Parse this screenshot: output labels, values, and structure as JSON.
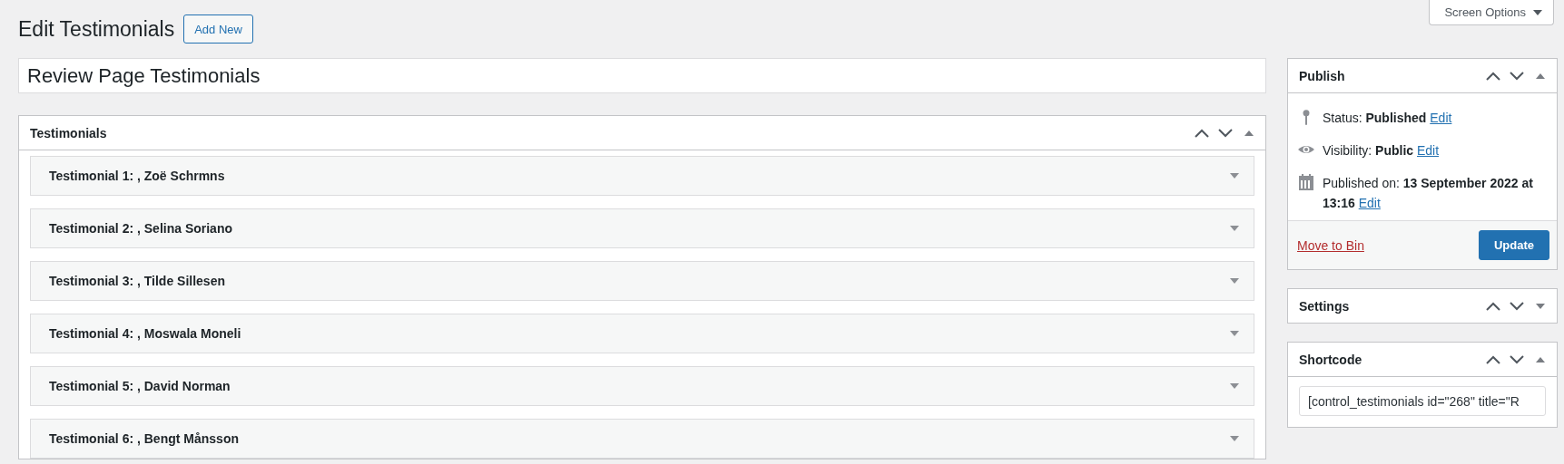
{
  "screen_options": {
    "label": "Screen Options",
    "expanded": false
  },
  "heading": {
    "title": "Edit Testimonials",
    "add_new": "Add New"
  },
  "title_field": {
    "value": "Review Page Testimonials"
  },
  "testimonials_panel": {
    "title": "Testimonials",
    "expanded": true,
    "items": [
      {
        "label": "Testimonial 1: , Zoë Schrmns",
        "expanded": false
      },
      {
        "label": "Testimonial 2: , Selina Soriano",
        "expanded": false
      },
      {
        "label": "Testimonial 3: , Tilde Sillesen",
        "expanded": false
      },
      {
        "label": "Testimonial 4: , Moswala Moneli",
        "expanded": false
      },
      {
        "label": "Testimonial 5: , David Norman",
        "expanded": false
      },
      {
        "label": "Testimonial 6: , Bengt Månsson",
        "expanded": false
      }
    ]
  },
  "publish": {
    "title": "Publish",
    "expanded": true,
    "rows": [
      {
        "kind": "pin",
        "text": "Status: **Published**",
        "link": "Edit"
      },
      {
        "kind": "eye",
        "text": "Visibility: **Public**",
        "link": "Edit"
      },
      {
        "kind": "calendar",
        "text": "Published on: **13 September 2022 at 13:16**",
        "link": "Edit"
      }
    ],
    "trash": "Move to Bin",
    "update": "Update"
  },
  "settings": {
    "title": "Settings",
    "expanded": false
  },
  "shortcode": {
    "title": "Shortcode",
    "expanded": true,
    "value": "[control_testimonials id=\"268\" title=\"R"
  }
}
